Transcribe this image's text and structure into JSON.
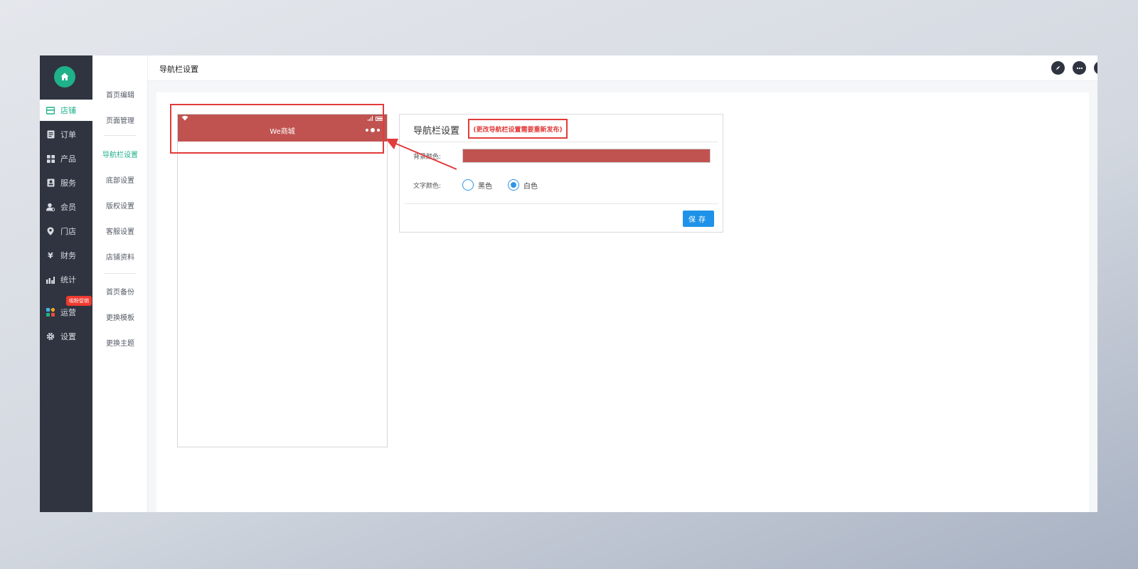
{
  "sidebar": {
    "items": [
      {
        "label": "店铺",
        "icon": "store-icon",
        "active": true
      },
      {
        "label": "订单",
        "icon": "order-icon",
        "active": false
      },
      {
        "label": "产品",
        "icon": "product-icon",
        "active": false
      },
      {
        "label": "服务",
        "icon": "service-icon",
        "active": false
      },
      {
        "label": "会员",
        "icon": "member-icon",
        "active": false
      },
      {
        "label": "门店",
        "icon": "location-icon",
        "active": false
      },
      {
        "label": "财务",
        "icon": "yen-icon",
        "active": false
      },
      {
        "label": "统计",
        "icon": "chart-icon",
        "active": false
      },
      {
        "label": "运营",
        "icon": "apps-icon",
        "active": false,
        "badge": "吸粉促销"
      },
      {
        "label": "设置",
        "icon": "gear-icon",
        "active": false
      }
    ]
  },
  "subnav": {
    "items": [
      {
        "label": "首页编辑"
      },
      {
        "label": "页面管理"
      },
      {
        "label": "导航栏设置",
        "active": true
      },
      {
        "label": "底部设置"
      },
      {
        "label": "版权设置"
      },
      {
        "label": "客服设置"
      },
      {
        "label": "店铺资料"
      },
      {
        "label": "首页备份"
      },
      {
        "label": "更换模板"
      },
      {
        "label": "更换主题"
      }
    ]
  },
  "header": {
    "title": "导航栏设置",
    "icons": [
      "compass-icon",
      "chat-icon",
      "help-icon",
      "user-icon"
    ]
  },
  "preview": {
    "title": "We商城",
    "bar_color": "#c05350"
  },
  "settings": {
    "title": "导航栏设置",
    "note": "(更改导航栏设置需要重新发布)",
    "bg_color_label": "背景颜色:",
    "bg_color_value": "#c05350",
    "text_color_label": "文字颜色:",
    "options": [
      {
        "label": "黑色",
        "selected": false
      },
      {
        "label": "白色",
        "selected": true
      }
    ],
    "save_label": "保存"
  },
  "colors": {
    "accent": "#1fb18a",
    "sidebar_bg": "#2f3440",
    "annotation": "#e23b3b",
    "primary_button": "#1e92e8"
  }
}
